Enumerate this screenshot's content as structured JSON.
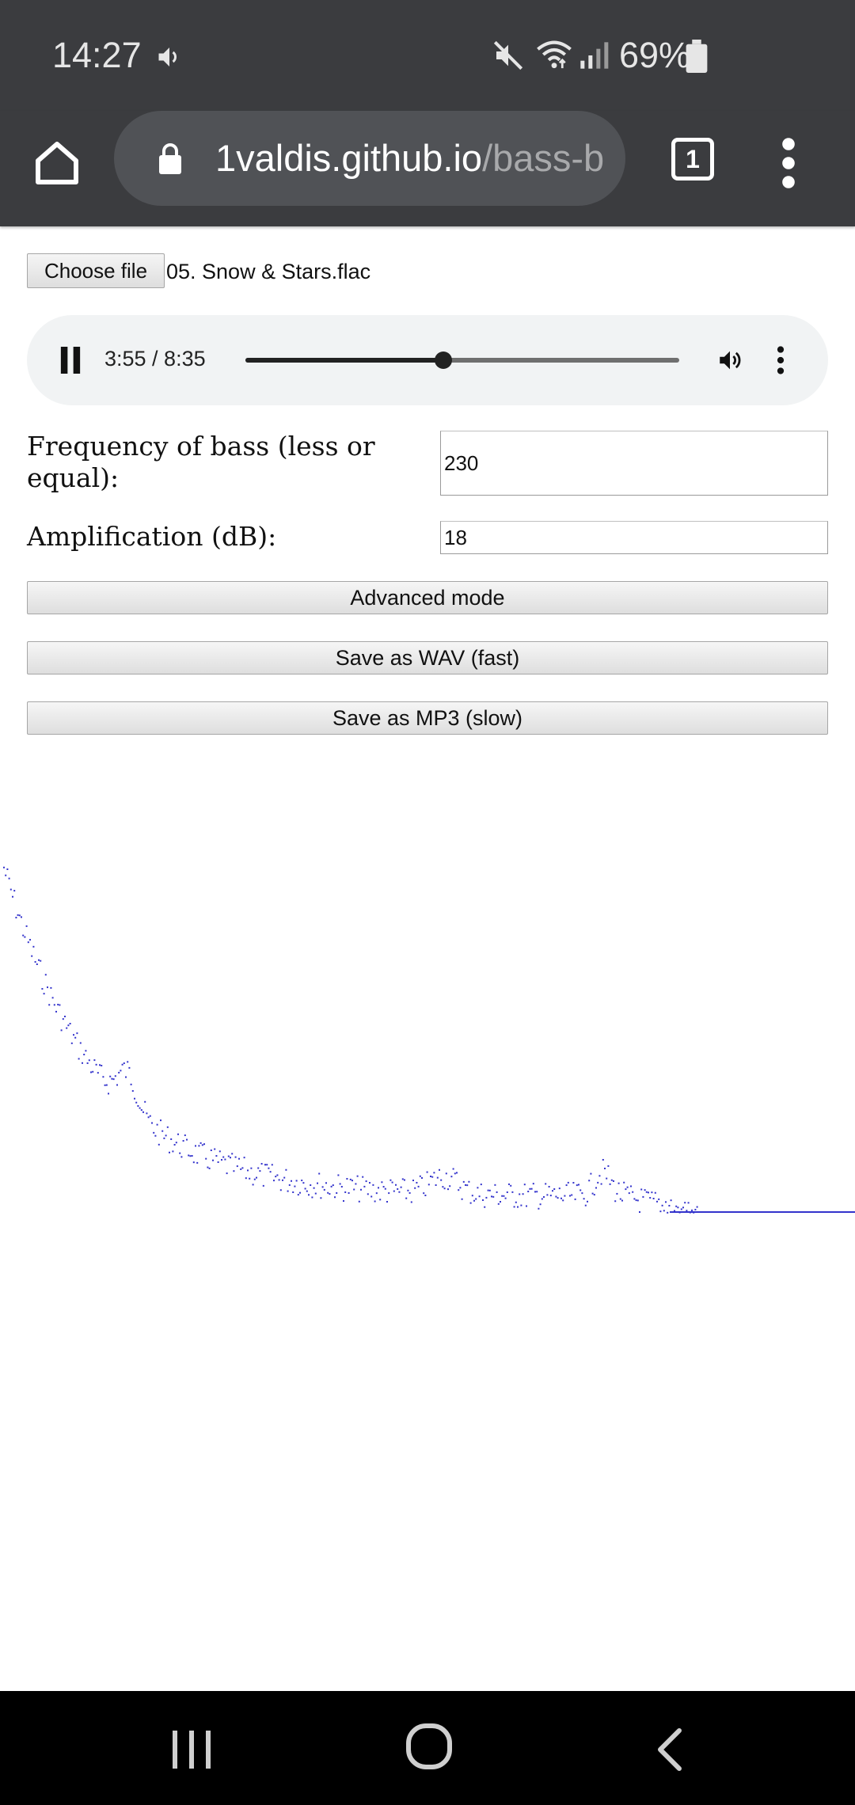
{
  "status_bar": {
    "time": "14:27",
    "battery": "69%",
    "icons": [
      "sound-icon",
      "mute-icon",
      "wifi-icon",
      "signal-icon",
      "battery-icon"
    ]
  },
  "browser": {
    "url_host": "1valdis.github.io",
    "url_rest": "/bass-b",
    "tab_count": "1",
    "colors": {
      "toolbar": "#3b3c3f",
      "omnibox": "#505256"
    }
  },
  "file_picker": {
    "button_label": "Choose file",
    "file_name": "05. Snow & Stars.flac"
  },
  "audio_player": {
    "time": "3:55 / 8:35",
    "progress_fraction": 0.457
  },
  "form": {
    "bass_frequency_label": "Frequency of bass (less or equal):",
    "bass_frequency_value": "230",
    "amplification_label": "Amplification (dB):",
    "amplification_value": "18"
  },
  "buttons": {
    "advanced": "Advanced mode",
    "save_wav": "Save as WAV (fast)",
    "save_mp3": "Save as MP3 (slow)"
  },
  "spectrum": {
    "color": "#3333cc",
    "shape": "decaying noisy dots, flattening to a solid line"
  },
  "nav_bar": {
    "icons": [
      "recents-icon",
      "home-icon",
      "back-icon"
    ]
  }
}
